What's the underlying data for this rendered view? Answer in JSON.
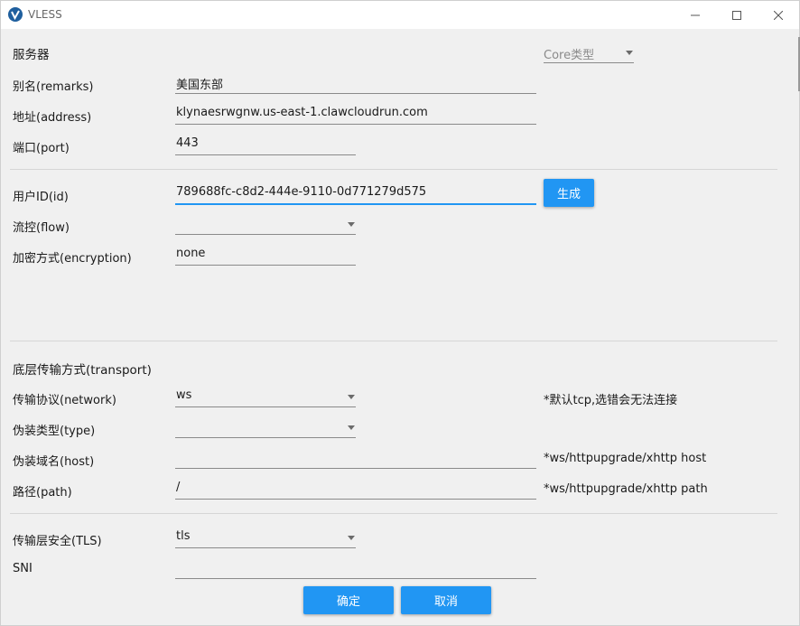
{
  "window": {
    "title": "VLESS"
  },
  "server": {
    "section_title": "服务器",
    "core_type_placeholder": "Core类型",
    "remarks_label": "别名(remarks)",
    "remarks_value": "美国东部",
    "address_label": "地址(address)",
    "address_value": "klynaesrwgnw.us-east-1.clawcloudrun.com",
    "port_label": "端口(port)",
    "port_value": "443"
  },
  "user": {
    "id_label": "用户ID(id)",
    "id_value": "789688fc-c8d2-444e-9110-0d771279d575",
    "generate_label": "生成",
    "flow_label": "流控(flow)",
    "flow_value": "",
    "encryption_label": "加密方式(encryption)",
    "encryption_value": "none"
  },
  "transport": {
    "section_title": "底层传输方式(transport)",
    "network_label": "传输协议(network)",
    "network_value": "ws",
    "network_hint": "*默认tcp,选错会无法连接",
    "type_label": "伪装类型(type)",
    "type_value": "",
    "host_label": "伪装域名(host)",
    "host_value": "",
    "host_hint": "*ws/httpupgrade/xhttp host",
    "path_label": "路径(path)",
    "path_value": "/",
    "path_hint": "*ws/httpupgrade/xhttp path"
  },
  "security": {
    "tls_label": "传输层安全(TLS)",
    "tls_value": "tls",
    "sni_label": "SNI",
    "sni_value": ""
  },
  "footer": {
    "ok_label": "确定",
    "cancel_label": "取消"
  },
  "colors": {
    "accent": "#2196f3",
    "background": "#f0f0f0"
  }
}
